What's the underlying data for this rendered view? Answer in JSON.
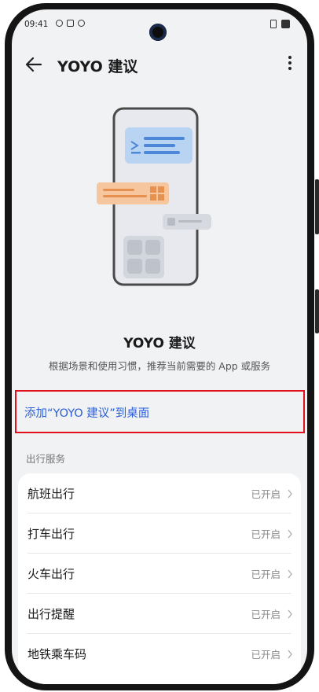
{
  "status_bar": {
    "time": "09:41",
    "icons": [
      "screen-record-icon",
      "mail-icon",
      "upload-icon",
      "dot-icon"
    ],
    "right_icons": [
      "sim-icon",
      "battery-icon"
    ]
  },
  "header": {
    "title": "YOYO 建议",
    "back_icon": "back-arrow-icon",
    "more_icon": "more-vertical-icon"
  },
  "intro": {
    "title": "YOYO 建议",
    "description": "根据场景和使用习惯，推荐当前需要的 App 或服务"
  },
  "add_link": {
    "label": "添加“YOYO 建议”到桌面"
  },
  "section": {
    "label": "出行服务",
    "items": [
      {
        "label": "航班出行",
        "status": "已开启"
      },
      {
        "label": "打车出行",
        "status": "已开启"
      },
      {
        "label": "火车出行",
        "status": "已开启"
      },
      {
        "label": "出行提醒",
        "status": "已开启"
      },
      {
        "label": "地铁乘车码",
        "status": "已开启"
      }
    ]
  },
  "colors": {
    "accent": "#2a5fd9",
    "highlight_border": "#e0101c",
    "background": "#f1f2f4",
    "card": "#ffffff"
  }
}
